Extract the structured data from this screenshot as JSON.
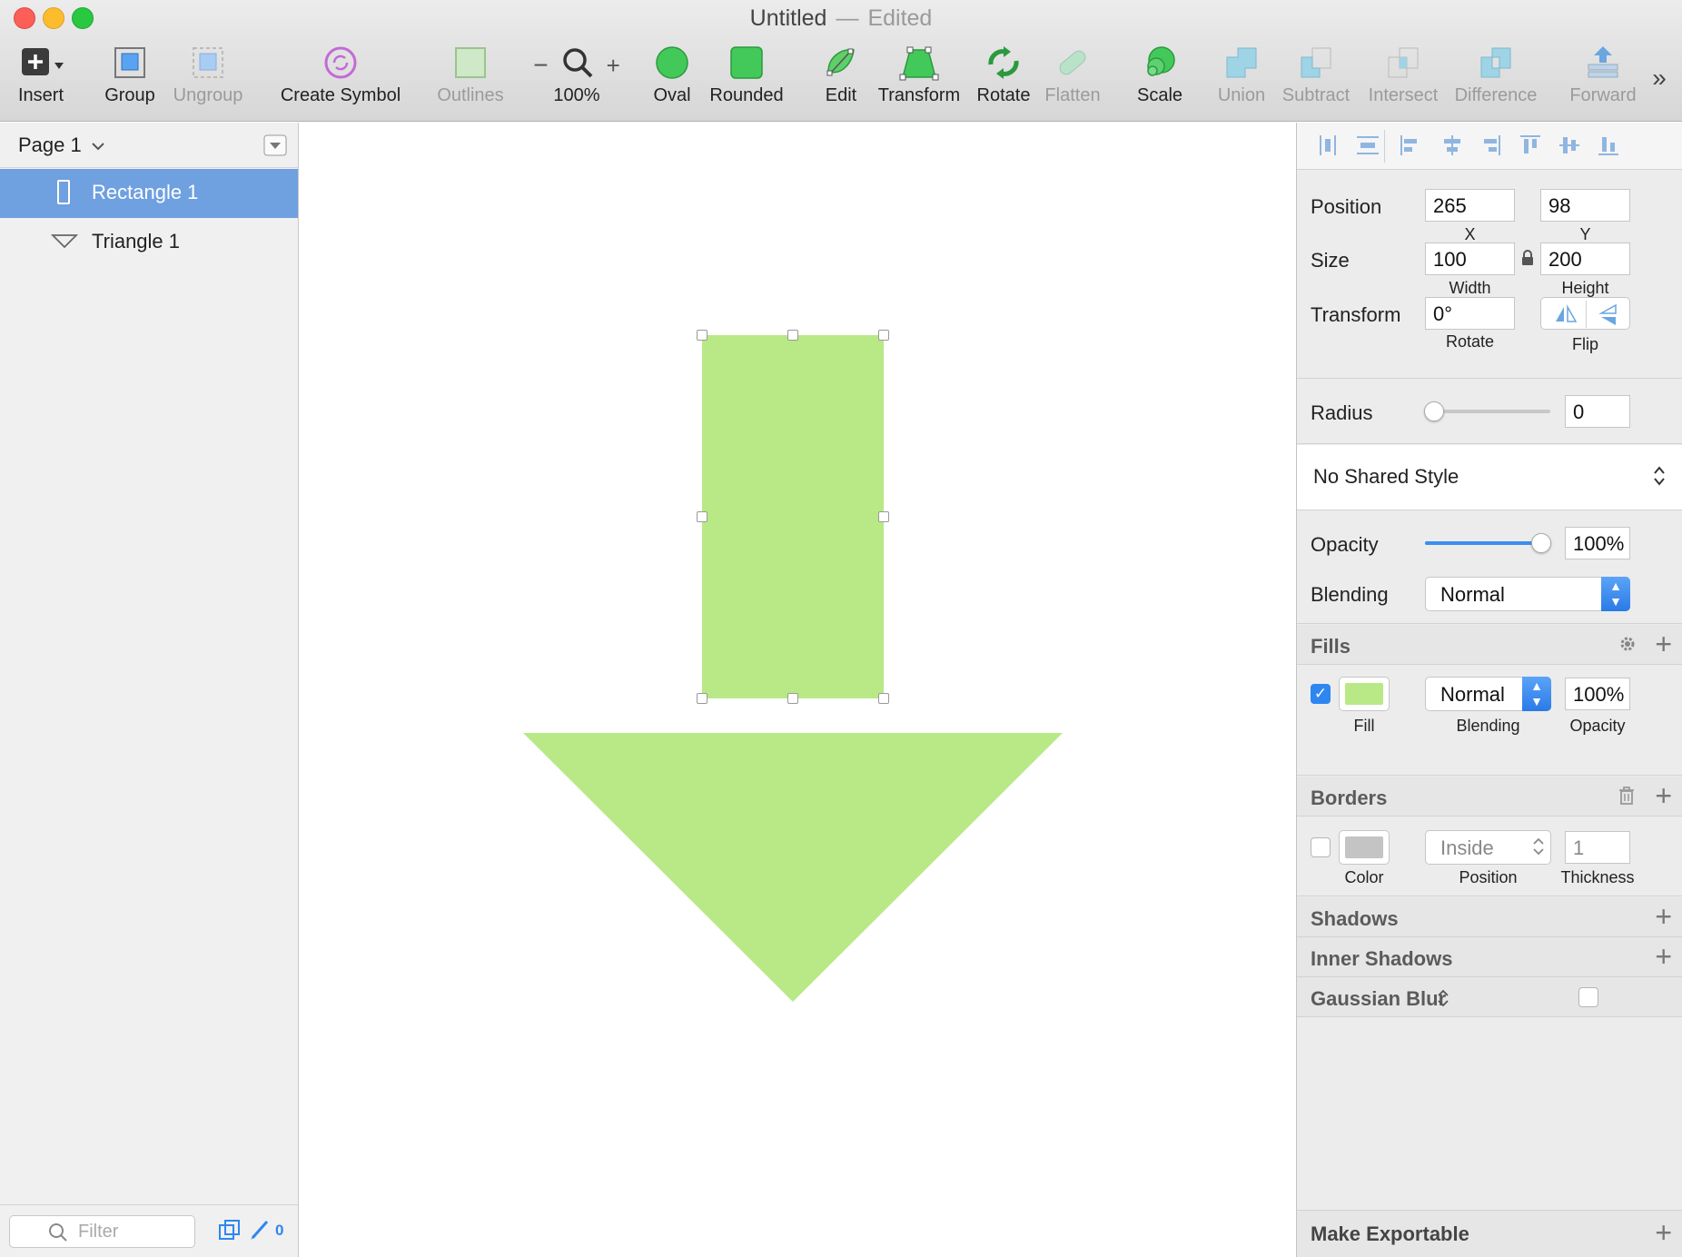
{
  "window": {
    "title": "Untitled",
    "separator": "—",
    "status": "Edited"
  },
  "toolbar": {
    "insert": "Insert",
    "group": "Group",
    "ungroup": "Ungroup",
    "create_symbol": "Create Symbol",
    "outlines": "Outlines",
    "zoom": "100%",
    "oval": "Oval",
    "rounded": "Rounded",
    "edit": "Edit",
    "transform": "Transform",
    "rotate": "Rotate",
    "flatten": "Flatten",
    "scale": "Scale",
    "union": "Union",
    "subtract": "Subtract",
    "intersect": "Intersect",
    "difference": "Difference",
    "forward": "Forward",
    "more": "»"
  },
  "layers": {
    "page": "Page 1",
    "items": [
      {
        "label": "Rectangle 1"
      },
      {
        "label": "Triangle 1"
      }
    ],
    "filter_placeholder": "Filter",
    "slice_count": "0"
  },
  "inspector": {
    "position": {
      "label": "Position",
      "x": "265",
      "y": "98",
      "x_label": "X",
      "y_label": "Y"
    },
    "size": {
      "label": "Size",
      "width": "100",
      "height": "200",
      "width_label": "Width",
      "height_label": "Height"
    },
    "transform": {
      "label": "Transform",
      "rotate": "0°",
      "rotate_label": "Rotate",
      "flip_label": "Flip"
    },
    "radius": {
      "label": "Radius",
      "value": "0"
    },
    "shared_style": "No Shared Style",
    "opacity": {
      "label": "Opacity",
      "value": "100%",
      "level": 1.0
    },
    "blending": {
      "label": "Blending",
      "value": "Normal"
    },
    "fills": {
      "title": "Fills",
      "blending": "Normal",
      "opacity": "100%",
      "fill_label": "Fill",
      "blending_label": "Blending",
      "opacity_label": "Opacity",
      "color": "#b8e986"
    },
    "borders": {
      "title": "Borders",
      "position": "Inside",
      "thickness": "1",
      "color_label": "Color",
      "position_label": "Position",
      "thickness_label": "Thickness",
      "color": "#c4c4c4"
    },
    "shadows": "Shadows",
    "inner_shadows": "Inner Shadows",
    "gaussian_blur": "Gaussian Blur",
    "make_exportable": "Make Exportable"
  },
  "colors": {
    "shape_fill": "#b8e986",
    "selection": "#6fa0e0",
    "accent": "#2e86f0"
  }
}
